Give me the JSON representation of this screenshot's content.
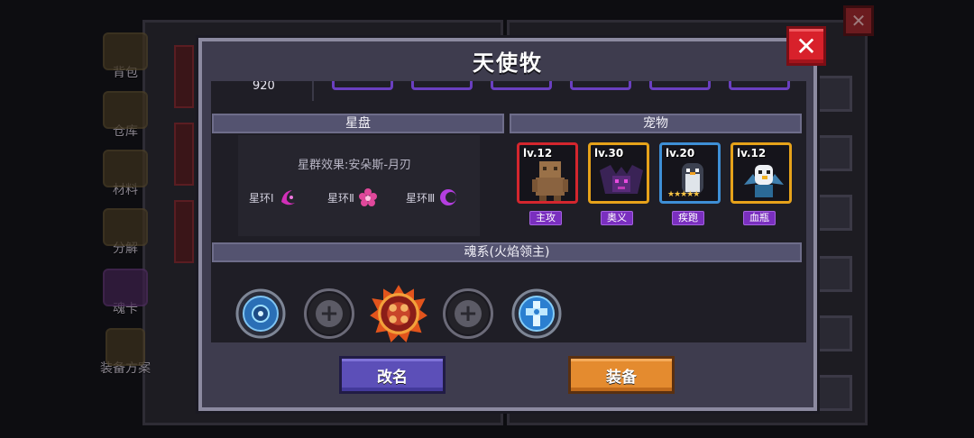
{
  "background": {
    "tabs": [
      {
        "label": "背包",
        "icon": "chest-icon"
      },
      {
        "label": "仓库",
        "icon": "warehouse-icon"
      },
      {
        "label": "材料",
        "icon": "materials-icon"
      },
      {
        "label": "分解",
        "icon": "dismantle-icon"
      },
      {
        "label": "魂卡",
        "icon": "soul-card-icon"
      },
      {
        "label": "装备方案",
        "icon": "equipment-plan-icon"
      }
    ]
  },
  "modal": {
    "title": "天使牧",
    "close_label": "✕",
    "top_number": "920",
    "constellation": {
      "header": "星盘",
      "effect": "星群效果:安朵斯-月刃",
      "rings": [
        {
          "label": "星环Ⅰ",
          "icon": "crescent-star-icon",
          "color": "#d12fb8"
        },
        {
          "label": "星环Ⅱ",
          "icon": "pink-flower-icon",
          "color": "#e0489b"
        },
        {
          "label": "星环Ⅲ",
          "icon": "purple-moon-icon",
          "color": "#b43ee0"
        }
      ]
    },
    "pets": {
      "header": "宠物",
      "items": [
        {
          "level": "lv.12",
          "tag": "主攻",
          "frame_color": "#d4262e",
          "icon": "golem-pet-icon"
        },
        {
          "level": "lv.30",
          "tag": "奥义",
          "frame_color": "#e6a21a",
          "icon": "shadow-bat-pet-icon"
        },
        {
          "level": "lv.20",
          "tag": "疾跑",
          "frame_color": "#3e8fd6",
          "icon": "penguin-pet-icon",
          "stars": "★★★★★"
        },
        {
          "level": "lv.12",
          "tag": "血瓶",
          "frame_color": "#e6a21a",
          "icon": "griffin-pet-icon"
        }
      ]
    },
    "soul": {
      "header": "魂系(火焰领主)",
      "slots": [
        {
          "state": "filled",
          "icon": "blue-rune-icon"
        },
        {
          "state": "empty",
          "icon": "plus-icon",
          "symbol": "+"
        },
        {
          "state": "filled",
          "icon": "fire-rune-icon"
        },
        {
          "state": "empty",
          "icon": "plus-icon",
          "symbol": "+"
        },
        {
          "state": "filled",
          "icon": "ice-rune-icon"
        }
      ]
    },
    "buttons": {
      "rename": "改名",
      "equip": "装备"
    }
  },
  "colors": {
    "accent_purple": "#6a3fc0",
    "equip_orange": "#e48b2f",
    "rename_purple": "#5c4fb8",
    "close_red": "#d8212b"
  }
}
